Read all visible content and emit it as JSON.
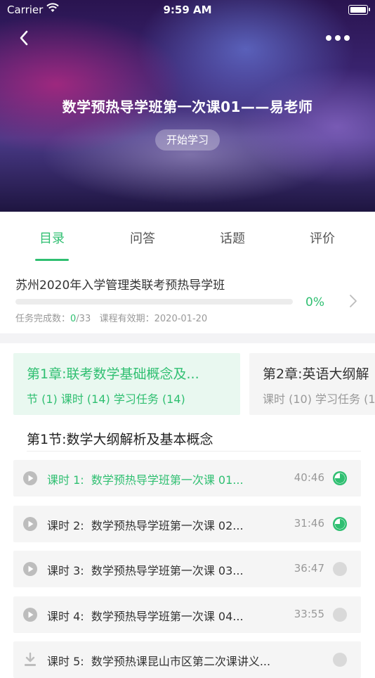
{
  "status_bar": {
    "carrier": "Carrier",
    "time": "9:59 AM"
  },
  "hero": {
    "title": "数学预热导学班第一次课01——易老师",
    "start_label": "开始学习"
  },
  "tabs": [
    {
      "label": "目录",
      "active": true
    },
    {
      "label": "问答",
      "active": false
    },
    {
      "label": "话题",
      "active": false
    },
    {
      "label": "评价",
      "active": false
    }
  ],
  "course": {
    "name": "苏州2020年入学管理类联考预热导学班",
    "progress": 0,
    "progress_label": "0%",
    "tasks_label": "任务完成数：",
    "tasks_done": "0",
    "tasks_total": "/33",
    "validity_label": "课程有效期：",
    "validity_date": "2020-01-20"
  },
  "chapters": [
    {
      "title": "第1章:联考数学基础概念及...",
      "stats": "节 (1) 课时 (14) 学习任务 (14)",
      "active": true
    },
    {
      "title": "第2章:英语大纲解",
      "stats": "课时 (10) 学习任务 (1",
      "active": false
    }
  ],
  "section": {
    "title": "第1节:数学大纲解析及基本概念"
  },
  "lessons": [
    {
      "label": "课时 1:",
      "title": "数学预热导学班第一次课 01...",
      "duration": "40:46",
      "icon": "play-icon",
      "progress": 0.75,
      "active": true
    },
    {
      "label": "课时 2:",
      "title": "数学预热导学班第一次课 02...",
      "duration": "31:46",
      "icon": "play-icon",
      "progress": 0.75,
      "active": false
    },
    {
      "label": "课时 3:",
      "title": "数学预热导学班第一次课 03...",
      "duration": "36:47",
      "icon": "play-icon",
      "progress": 0,
      "active": false
    },
    {
      "label": "课时 4:",
      "title": "数学预热导学班第一次课 04...",
      "duration": "33:55",
      "icon": "play-icon",
      "progress": 0,
      "active": false
    },
    {
      "label": "课时 5:",
      "title": "数学预热课昆山市区第二次课讲义...",
      "duration": "",
      "icon": "download-icon",
      "progress": 0,
      "active": false
    }
  ],
  "colors": {
    "accent": "#2fbf71",
    "muted": "#d9d9d9"
  }
}
